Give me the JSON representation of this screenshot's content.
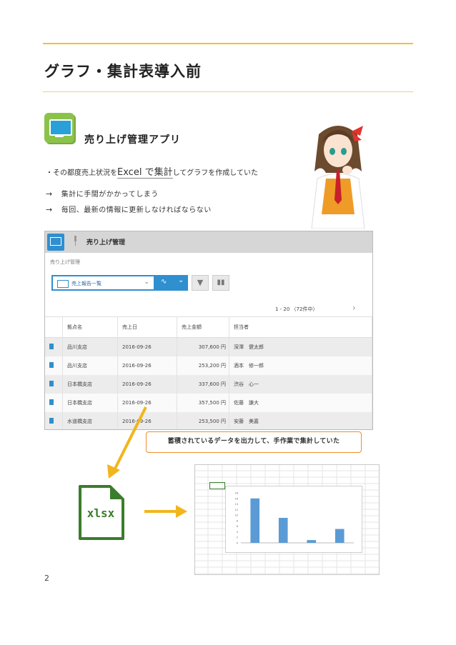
{
  "page": {
    "title": "グラフ・集計表導入前",
    "page_number": "2"
  },
  "app": {
    "name": "売り上げ管理アプリ",
    "description_pre": "・その都度売上状況を",
    "description_emph": "Excel で集計",
    "description_post": "してグラフを作成していた",
    "bullets": [
      {
        "arrow": "→",
        "text": "集計に手間がかかってしまう"
      },
      {
        "arrow": "→",
        "text": "毎回、最新の情報に更新しなければならない"
      }
    ]
  },
  "screenshot": {
    "header_title": "売り上げ管理",
    "subtitle": "売り上げ管理",
    "view_selector": "売上報告一覧",
    "pager": "1 - 20 （72件中）",
    "columns": [
      "拠点名",
      "売上日",
      "売上金額",
      "担当者"
    ],
    "rows": [
      {
        "branch": "品川支店",
        "date": "2016-09-26",
        "amount": "307,600 円",
        "person": "深澤　健太郎"
      },
      {
        "branch": "品川支店",
        "date": "2016-09-26",
        "amount": "253,200 円",
        "person": "酒本　修一郎"
      },
      {
        "branch": "日本橋支店",
        "date": "2016-09-26",
        "amount": "337,600 円",
        "person": "渋谷　心一"
      },
      {
        "branch": "日本橋支店",
        "date": "2016-09-26",
        "amount": "357,500 円",
        "person": "佐藤　謙大"
      },
      {
        "branch": "水道橋支店",
        "date": "2016-09-26",
        "amount": "253,500 円",
        "person": "安藤　美嘉"
      }
    ]
  },
  "callout": "蓄積されているデータを出力して、手作業で集計していた",
  "xlsx_label": "xlsx",
  "colors": {
    "accent_rule": "#f2c230",
    "callout_border": "#f28c28",
    "arrow": "#f2b51c",
    "xlsx_green": "#3a7d2c",
    "kintone_blue": "#2f8fcf",
    "bar_blue": "#5b9bd5"
  },
  "chart_data": {
    "type": "bar",
    "categories": [
      "",
      "",
      "",
      ""
    ],
    "values": [
      16,
      9,
      1,
      5
    ],
    "ylim": [
      0,
      18
    ],
    "yticks": [
      "0",
      "2",
      "4",
      "6",
      "8",
      "10",
      "12",
      "14",
      "16",
      "18"
    ],
    "grid": false
  }
}
